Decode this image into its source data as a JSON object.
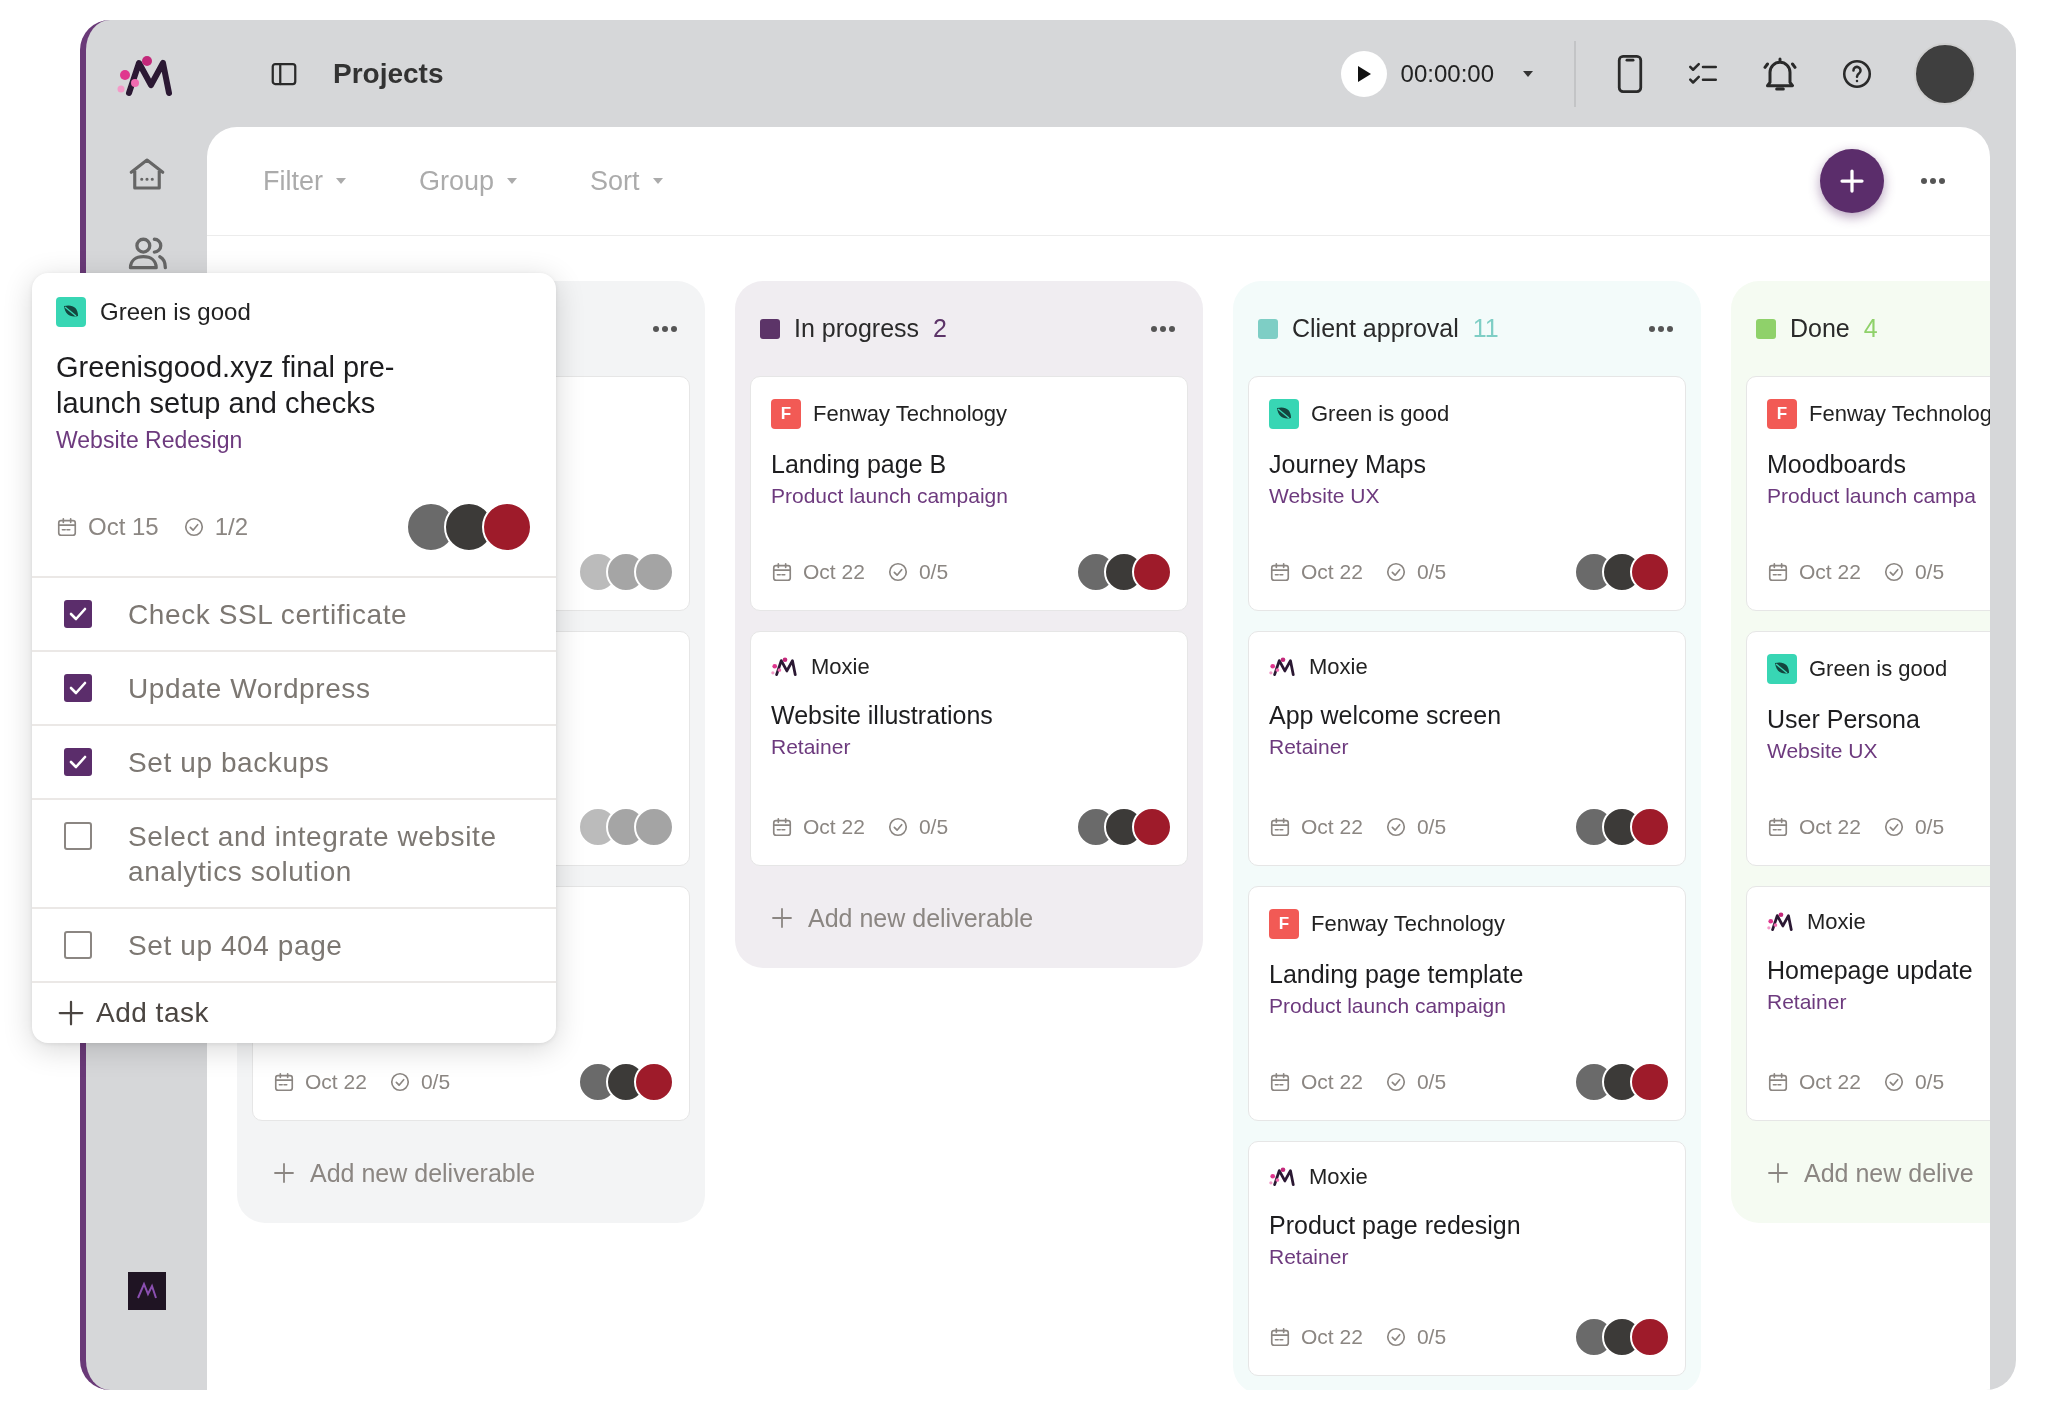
{
  "header": {
    "title": "Projects",
    "timer": "00:00:00"
  },
  "toolbar": {
    "dropdowns": [
      "Filter",
      "Group",
      "Sort"
    ]
  },
  "columns": [
    {
      "show_menu": true,
      "cards": [
        {
          "faded": true
        },
        {
          "faded": true
        },
        {
          "faded": false,
          "date": "Oct 22",
          "tasks": "0/5"
        }
      ],
      "add_label": "Add new deliverable"
    },
    {
      "title": "In progress",
      "count": "2",
      "color": "#5c3468",
      "show_menu": true,
      "cards": [
        {
          "client": {
            "kind": "letter",
            "letter": "F",
            "name": "Fenway Technology"
          },
          "title": "Landing page B",
          "project": "Product launch campaign",
          "date": "Oct 22",
          "tasks": "0/5"
        },
        {
          "client": {
            "kind": "moxie",
            "name": "Moxie"
          },
          "title": "Website illustrations",
          "project": "Retainer",
          "date": "Oct 22",
          "tasks": "0/5"
        }
      ],
      "add_label": "Add new deliverable"
    },
    {
      "title": "Client approval",
      "count": "11",
      "color": "#7ecec5",
      "show_menu": true,
      "cards": [
        {
          "client": {
            "kind": "leaf",
            "name": "Green is good"
          },
          "title": "Journey Maps",
          "project": "Website UX",
          "date": "Oct 22",
          "tasks": "0/5"
        },
        {
          "client": {
            "kind": "moxie",
            "name": "Moxie"
          },
          "title": "App welcome screen",
          "project": "Retainer",
          "date": "Oct 22",
          "tasks": "0/5"
        },
        {
          "client": {
            "kind": "letter",
            "letter": "F",
            "name": "Fenway Technology"
          },
          "title": "Landing page template",
          "project": "Product launch campaign",
          "date": "Oct 22",
          "tasks": "0/5"
        },
        {
          "client": {
            "kind": "moxie",
            "name": "Moxie"
          },
          "title": "Product page redesign",
          "project": "Retainer",
          "date": "Oct 22",
          "tasks": "0/5"
        }
      ]
    },
    {
      "title": "Done",
      "count": "4",
      "color": "#8fd16a",
      "show_menu": false,
      "cards": [
        {
          "client": {
            "kind": "letter",
            "letter": "F",
            "name": "Fenway Technolog"
          },
          "title": "Moodboards",
          "project": "Product launch campa",
          "date": "Oct 22",
          "tasks": "0/5"
        },
        {
          "client": {
            "kind": "leaf",
            "name": "Green is good"
          },
          "title": "User Persona",
          "project": "Website UX",
          "date": "Oct 22",
          "tasks": "0/5"
        },
        {
          "client": {
            "kind": "moxie",
            "name": "Moxie"
          },
          "title": "Homepage update",
          "project": "Retainer",
          "date": "Oct 22",
          "tasks": "0/5"
        }
      ],
      "add_label": "Add new delive"
    }
  ],
  "popup": {
    "client": {
      "kind": "leaf",
      "name": "Green is good"
    },
    "title": "Greenisgood.xyz final pre-launch setup and checks",
    "project": "Website Redesign",
    "date": "Oct 15",
    "tasks": "1/2",
    "checklist": [
      {
        "text": "Check SSL certificate",
        "checked": true
      },
      {
        "text": "Update Wordpress",
        "checked": true
      },
      {
        "text": "Set up backups",
        "checked": true
      },
      {
        "text": "Select and integrate website analytics solution",
        "checked": false
      },
      {
        "text": "Set up 404 page",
        "checked": false
      }
    ],
    "add_label": "Add task"
  }
}
